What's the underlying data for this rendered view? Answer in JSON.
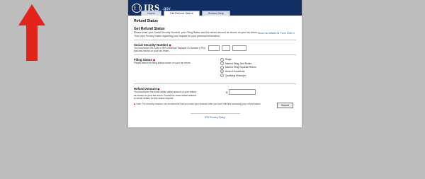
{
  "brand": {
    "name": "IRS",
    "suffix": ".gov"
  },
  "tabs": [
    {
      "label": "Home"
    },
    {
      "label": "Get Refund Status"
    },
    {
      "label": "Refund Help"
    }
  ],
  "crumb": "Refund Status",
  "title": "Get Refund Status",
  "sidebar_link": "Show me details for Form 1040-X",
  "intro": [
    "Please enter your Social Security Number, your Filing Status and the refund amount as shown on your tax return.",
    "Then click Privacy Notice regarding your request for your personal information."
  ],
  "ssn": {
    "label": "Social Security Number",
    "help": [
      "You must enter the SSN or IRS Individual Taxpayer ID Number (ITIN)",
      "that was shown on your tax return."
    ]
  },
  "filing": {
    "label": "Filing Status",
    "help": "Please select the filing status shown on your tax return.",
    "options": [
      "Single",
      "Married Filing Joint Return",
      "Married Filing Separate Return",
      "Head of Household",
      "Qualifying Widow(er)"
    ]
  },
  "refund": {
    "label": "Refund Amount",
    "help": [
      "You must enter the exact whole dollar amount of your refund",
      "as shown on your tax return. Round the exact whole amount",
      "to whole dollars for this status request."
    ],
    "currency": "$"
  },
  "note": "Note: For security reasons, we recommend that you close your browser after you have finished accessing your refund status.",
  "submit_label": "Submit",
  "footer_link": "IRS Privacy Policy"
}
